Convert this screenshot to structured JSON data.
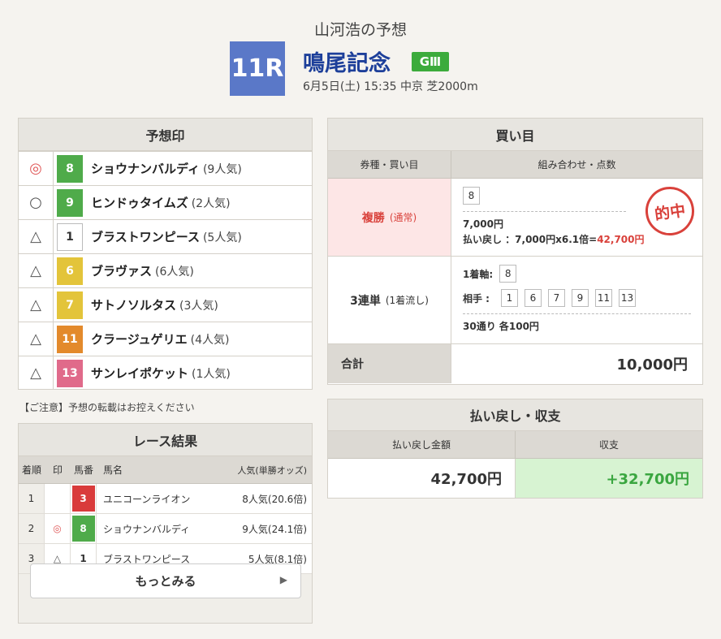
{
  "header": {
    "title": "山河浩の予想",
    "race_number": "11R",
    "race_name": "鳴尾記念",
    "grade": "GⅢ",
    "info": "6月5日(土) 15:35 中京 芝2000m"
  },
  "prediction": {
    "title": "予想印",
    "rows": [
      {
        "mark": "◎",
        "number": "8",
        "name": "ショウナンバルディ",
        "pop": "(9人気)"
      },
      {
        "mark": "○",
        "number": "9",
        "name": "ヒンドゥタイムズ",
        "pop": "(2人気)"
      },
      {
        "mark": "△",
        "number": "1",
        "name": "ブラストワンピース",
        "pop": "(5人気)"
      },
      {
        "mark": "△",
        "number": "6",
        "name": "ブラヴァス",
        "pop": "(6人気)"
      },
      {
        "mark": "△",
        "number": "7",
        "name": "サトノソルタス",
        "pop": "(3人気)"
      },
      {
        "mark": "△",
        "number": "11",
        "name": "クラージュゲリエ",
        "pop": "(4人気)"
      },
      {
        "mark": "△",
        "number": "13",
        "name": "サンレイポケット",
        "pop": "(1人気)"
      }
    ],
    "colors": [
      "#4fab4a",
      "#4fab4a",
      "#ffffff",
      "#e3c43a",
      "#e3c43a",
      "#e38a2c",
      "#e06a8a"
    ],
    "notice": "【ご注意】予想の転載はお控えください"
  },
  "results": {
    "title": "レース結果",
    "headers": {
      "finish": "着順",
      "mark": "印",
      "number": "馬番",
      "name": "馬名",
      "pop": "人気(単勝オッズ)"
    },
    "rows": [
      {
        "finish": "1",
        "mark": "",
        "number": "3",
        "name": "ユニコーンライオン",
        "pop": "8人気(20.6倍)",
        "color": "#d93b3b"
      },
      {
        "finish": "2",
        "mark": "◎",
        "number": "8",
        "name": "ショウナンバルディ",
        "pop": "9人気(24.1倍)",
        "color": "#4fab4a"
      },
      {
        "finish": "3",
        "mark": "△",
        "number": "1",
        "name": "ブラストワンピース",
        "pop": "5人気(8.1倍)",
        "color": "#ffffff"
      }
    ],
    "more_label": "もっとみる"
  },
  "bets": {
    "title": "買い目",
    "col_type": "券種・買い目",
    "col_combo": "組み合わせ・点数",
    "fukusho": {
      "type": "複勝",
      "sub": "(通常)",
      "number": "8",
      "amount": "7,000円",
      "payout_prefix": "払い戻し ：7,000円x6.1倍=",
      "payout_value": "42,700円",
      "stamp": "的中"
    },
    "sanrentan": {
      "type": "3連単",
      "sub": "(1着流し)",
      "axis_label": "1着軸:",
      "axis": "8",
      "partner_label": "相手 :",
      "partners": [
        "1",
        "6",
        "7",
        "9",
        "11",
        "13"
      ],
      "summary": "30通り 各100円"
    },
    "total_label": "合計",
    "total_value": "10,000円"
  },
  "payout": {
    "title": "払い戻し・収支",
    "col_payout": "払い戻し金額",
    "col_balance": "収支",
    "payout_value": "42,700円",
    "balance_value": "+32,700円"
  }
}
